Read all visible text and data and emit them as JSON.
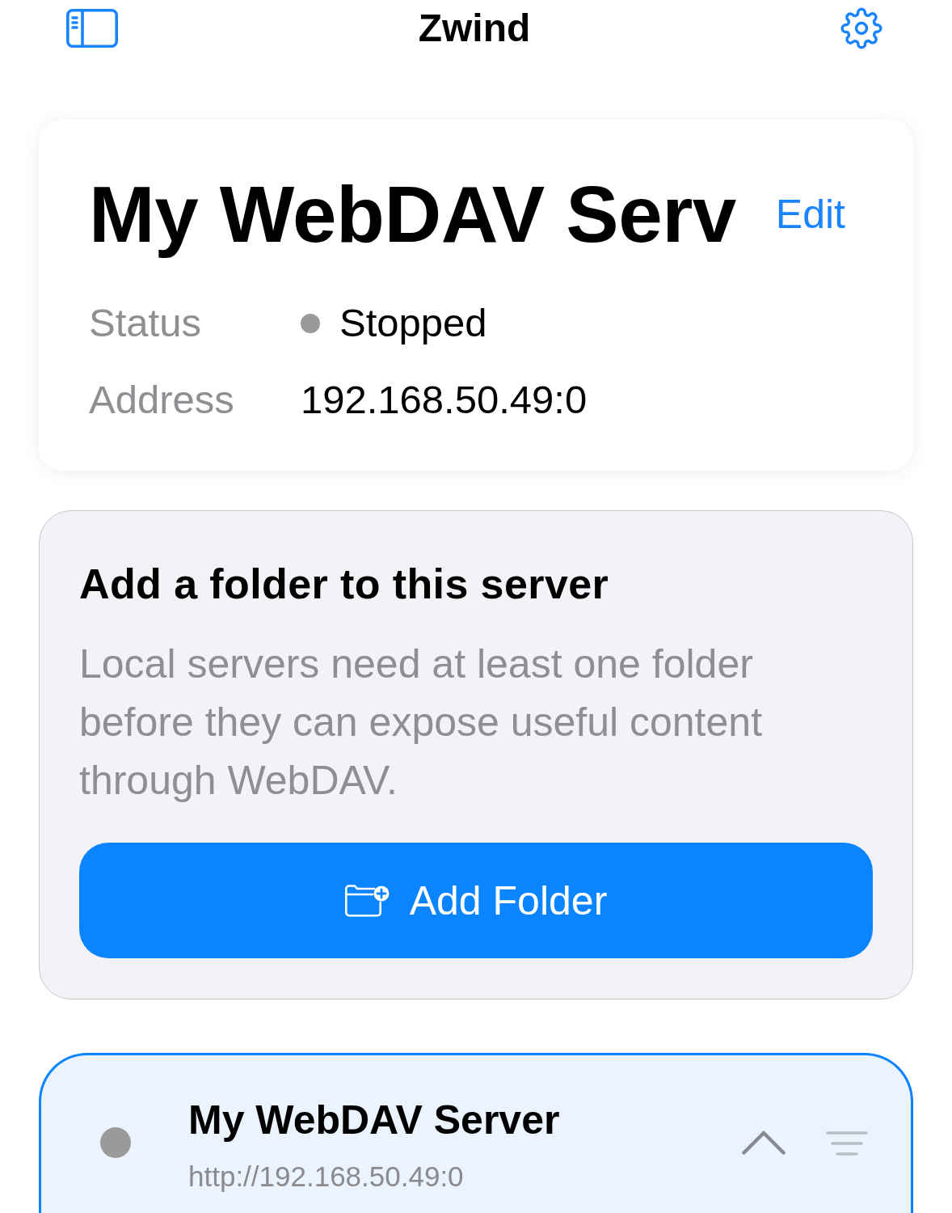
{
  "header": {
    "title": "Zwind"
  },
  "server_card": {
    "title": "My WebDAV Serv",
    "edit_link": "Edit",
    "fields": [
      {
        "kind": "status",
        "label": "Status",
        "value": "Stopped",
        "running": false
      },
      {
        "kind": "text",
        "label": "Address",
        "value": "192.168.50.49:0"
      }
    ]
  },
  "folder_prompt": {
    "heading": "Add a folder to this server",
    "description": "Local servers need at least one folder before they can expose useful content through WebDAV.",
    "button": "Add Folder"
  },
  "servers": [
    {
      "name": "My WebDAV Server",
      "url": "http://192.168.50.49:0",
      "running": false,
      "selected": true,
      "expanded": true
    }
  ]
}
